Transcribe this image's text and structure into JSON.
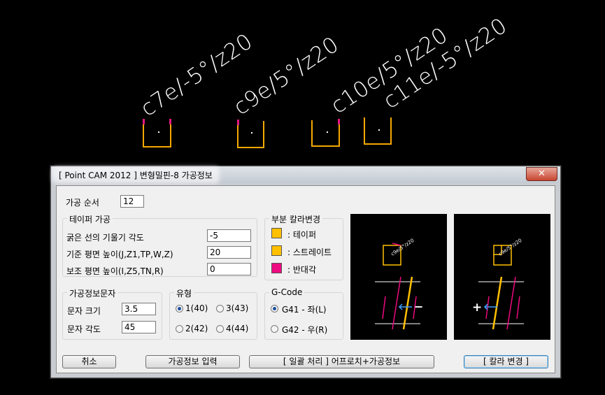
{
  "cad": {
    "labels": [
      "c7e/-5°/z20",
      "c9e/5°/z20",
      "c10e/5°/z20",
      "c11e/-5°/z20"
    ]
  },
  "dialog": {
    "title": "[ Point CAM 2012 ] 변형밀핀-8 가공정보",
    "close_icon": "✕",
    "seq_label": "가공 순서",
    "seq_value": "12",
    "taper": {
      "title": "테이퍼 가공",
      "angle_label": "굵은 선의 기울기 각도",
      "angle_value": "-5",
      "base_label": "기준 평면 높이(J,Z1,TP,W,Z)",
      "base_value": "20",
      "aux_label": "보조 평면 높이(I,Z5,TN,R)",
      "aux_value": "0"
    },
    "color": {
      "title": "부분 칼라변경",
      "items": [
        {
          "label": ": 테이퍼",
          "color": "#ffc000"
        },
        {
          "label": ": 스트레이트",
          "color": "#ffc000"
        },
        {
          "label": ": 반대각",
          "color": "#ee0a80"
        }
      ]
    },
    "text_info": {
      "title": "가공정보문자",
      "size_label": "문자 크기",
      "size_value": "3.5",
      "angle_label": "문자 각도",
      "angle_value": "45"
    },
    "type": {
      "title": "유형",
      "options": [
        "1(40)",
        "3(43)",
        "2(42)",
        "4(44)"
      ]
    },
    "gcode": {
      "title": "G-Code",
      "options": [
        "G41 - 좌(L)",
        "G42 - 우(R)"
      ]
    },
    "buttons": {
      "cancel": "취소",
      "input": "가공정보 입력",
      "batch": "[ 일괄 처리 ]  어프로치+가공정보",
      "change_color": "[ 칼라 변경 ]"
    },
    "preview": {
      "left_text": "c9e/5°/z20",
      "right_text": "c9e/5°/z20",
      "minus": "−",
      "plus": "+"
    }
  },
  "colors": {
    "taper": "#ffc000",
    "reverse": "#ee0a80",
    "arrow": "#3ea0ff"
  }
}
